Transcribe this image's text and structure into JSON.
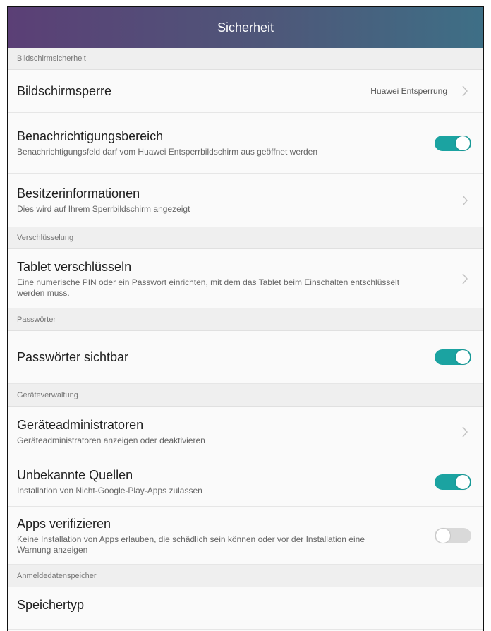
{
  "header": {
    "title": "Sicherheit"
  },
  "sections": {
    "screen_security": "Bildschirmsicherheit",
    "encryption": "Verschlüsselung",
    "passwords": "Passwörter",
    "device_admin": "Geräteverwaltung",
    "credential_storage": "Anmeldedatenspeicher"
  },
  "rows": {
    "screen_lock": {
      "title": "Bildschirmsperre",
      "value": "Huawei Entsperrung"
    },
    "notification_area": {
      "title": "Benachrichtigungsbereich",
      "subtitle": "Benachrichtigungsfeld darf vom Huawei Entsperrbildschirm aus geöffnet werden",
      "enabled": true
    },
    "owner_info": {
      "title": "Besitzerinformationen",
      "subtitle": "Dies wird auf Ihrem Sperrbildschirm angezeigt"
    },
    "encrypt_tablet": {
      "title": "Tablet verschlüsseln",
      "subtitle": "Eine numerische PIN oder ein Passwort einrichten, mit dem das Tablet beim Einschalten entschlüsselt werden muss."
    },
    "show_passwords": {
      "title": "Passwörter sichtbar",
      "enabled": true
    },
    "device_admins": {
      "title": "Geräteadministratoren",
      "subtitle": "Geräteadministratoren anzeigen oder deaktivieren"
    },
    "unknown_sources": {
      "title": "Unbekannte Quellen",
      "subtitle": "Installation von Nicht-Google-Play-Apps zulassen",
      "enabled": true
    },
    "verify_apps": {
      "title": "Apps verifizieren",
      "subtitle": "Keine Installation von Apps erlauben, die schädlich sein können oder vor der Installation eine Warnung anzeigen",
      "enabled": false
    },
    "storage_type": {
      "title": "Speichertyp"
    }
  },
  "colors": {
    "accent": "#1ba3a1",
    "toggle_off": "#d9d9d9"
  },
  "icons": {
    "chevron": "chevron-right-icon"
  }
}
